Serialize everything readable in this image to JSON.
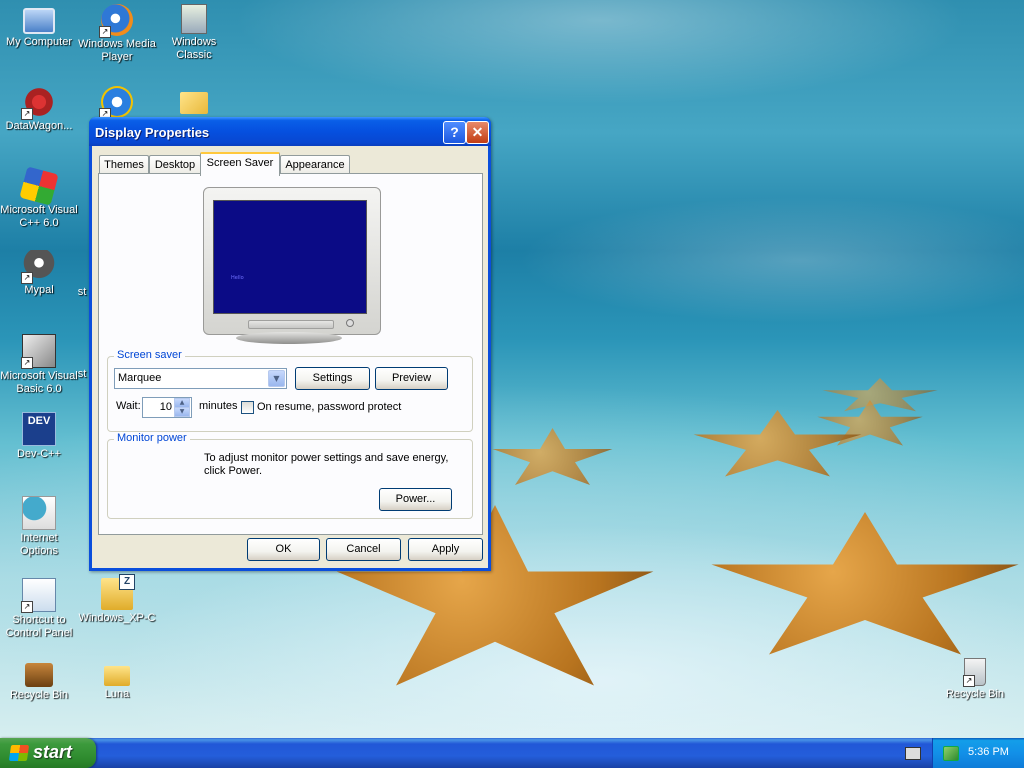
{
  "desktop": {
    "icons": [
      {
        "label": "My Computer",
        "icon": "my-computer-icon"
      },
      {
        "label": "Windows Media Player",
        "icon": "windows-media-player-icon"
      },
      {
        "label": "Windows Classic",
        "icon": "windows-classic-icon"
      },
      {
        "label": "DataWagon...",
        "icon": "datawagon-icon"
      },
      {
        "label": "",
        "icon": "internet-explorer-icon"
      },
      {
        "label": "",
        "icon": "open-folder-icon"
      },
      {
        "label": "Microsoft Visual C++ 6.0",
        "icon": "visual-cpp-icon"
      },
      {
        "label": "Mypal",
        "icon": "mypal-icon"
      },
      {
        "label": "Microsoft Visual Basic 6.0",
        "icon": "visual-basic-icon"
      },
      {
        "label": "Dev-C++",
        "icon": "dev-cpp-icon"
      },
      {
        "label": "Internet Options",
        "icon": "internet-options-icon"
      },
      {
        "label": "Shortcut to Control Panel",
        "icon": "control-panel-shortcut-icon"
      },
      {
        "label": "Windows_XP-C",
        "icon": "zip-folder-icon"
      },
      {
        "label": "Recycle Bin",
        "icon": "treasure-chest-icon"
      },
      {
        "label": "Luna",
        "icon": "folder-icon"
      },
      {
        "label": "Recycle Bin",
        "icon": "recycle-bin-icon"
      }
    ],
    "stray_text_1": "st",
    "stray_text_2": "st"
  },
  "window": {
    "title": "Display Properties",
    "help_glyph": "?",
    "close_glyph": "✕",
    "tabs": [
      {
        "label": "Themes"
      },
      {
        "label": "Desktop"
      },
      {
        "label": "Screen Saver"
      },
      {
        "label": "Appearance"
      }
    ],
    "active_tab": "Screen Saver",
    "preview_text": "Hello",
    "screen_saver": {
      "group_label": "Screen saver",
      "selected": "Marquee",
      "dropdown_glyph": "▼",
      "settings_label": "Settings",
      "preview_label": "Preview",
      "wait_label": "Wait:",
      "wait_value": "10",
      "minutes_label": "minutes",
      "password_label": "On resume, password protect",
      "password_checked": false
    },
    "monitor_power": {
      "group_label": "Monitor power",
      "description": "To adjust monitor power settings and save energy, click Power.",
      "power_label": "Power..."
    },
    "buttons": {
      "ok": "OK",
      "cancel": "Cancel",
      "apply": "Apply"
    }
  },
  "taskbar": {
    "start_label": "start",
    "clock": "5:36 PM"
  }
}
